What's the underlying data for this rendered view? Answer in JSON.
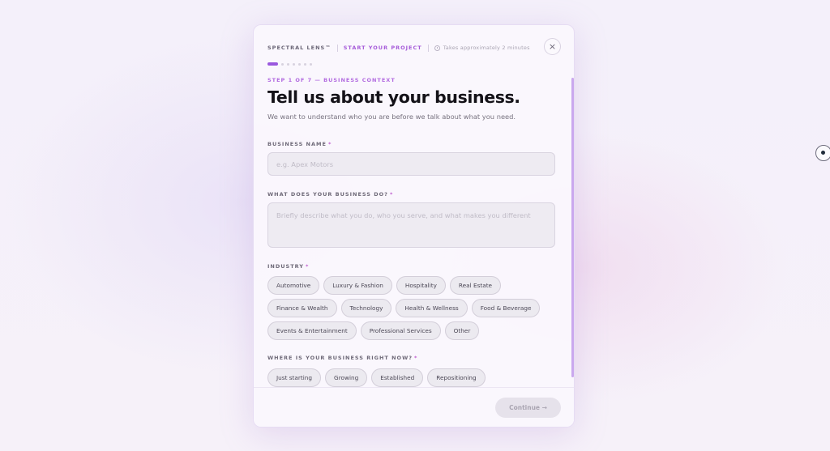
{
  "header": {
    "brand": "SPECTRAL LENS™",
    "project": "START YOUR PROJECT",
    "timer": "Takes approximately 2 minutes",
    "close_icon": "×"
  },
  "progress": {
    "current_step": 1,
    "total_steps": 7
  },
  "step_label": "STEP 1 OF 7 — BUSINESS CONTEXT",
  "title": "Tell us about your business.",
  "subtitle": "We want to understand who you are before we talk about what you need.",
  "fields": {
    "business_name": {
      "label": "BUSINESS NAME",
      "required": "*",
      "placeholder": "e.g. Apex Motors",
      "value": ""
    },
    "description": {
      "label": "WHAT DOES YOUR BUSINESS DO?",
      "required": "*",
      "placeholder": "Briefly describe what you do, who you serve, and what makes you different",
      "value": ""
    }
  },
  "industry": {
    "label": "INDUSTRY",
    "required": "*",
    "options": [
      "Automotive",
      "Luxury & Fashion",
      "Hospitality",
      "Real Estate",
      "Finance & Wealth",
      "Technology",
      "Health & Wellness",
      "Food & Beverage",
      "Events & Entertainment",
      "Professional Services",
      "Other"
    ]
  },
  "stage": {
    "label": "WHERE IS YOUR BUSINESS RIGHT NOW?",
    "required": "*",
    "options": [
      "Just starting",
      "Growing",
      "Established",
      "Repositioning"
    ]
  },
  "footer": {
    "continue_label": "Continue →"
  }
}
